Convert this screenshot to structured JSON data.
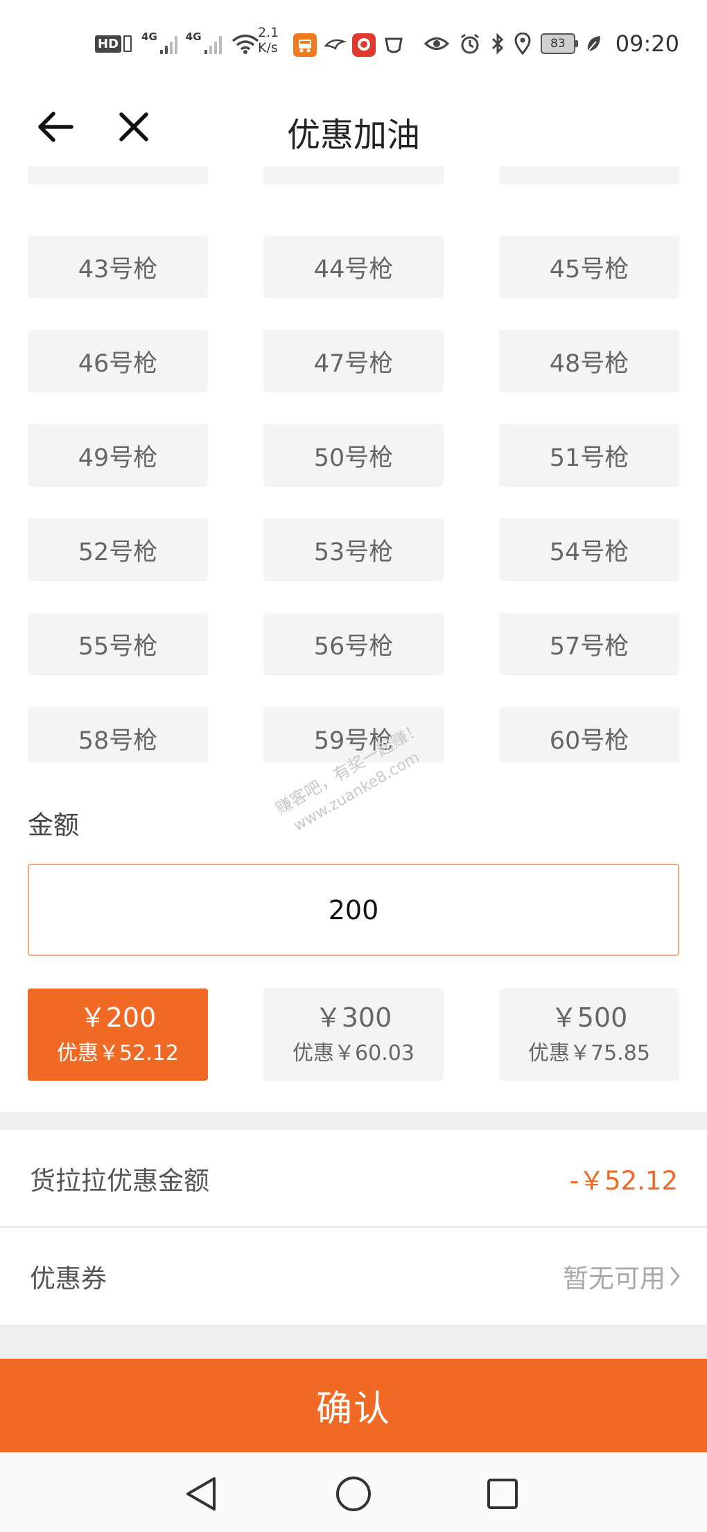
{
  "status_bar": {
    "hd": "HD",
    "net1": "4G",
    "net2": "4G",
    "speed_value": "2.1",
    "speed_unit": "K/s",
    "battery": "83",
    "time": "09:20"
  },
  "header": {
    "title": "优惠加油"
  },
  "nozzles": {
    "rows": [
      [
        "",
        "",
        ""
      ],
      [
        "43号枪",
        "44号枪",
        "45号枪"
      ],
      [
        "46号枪",
        "47号枪",
        "48号枪"
      ],
      [
        "49号枪",
        "50号枪",
        "51号枪"
      ],
      [
        "52号枪",
        "53号枪",
        "54号枪"
      ],
      [
        "55号枪",
        "56号枪",
        "57号枪"
      ],
      [
        "58号枪",
        "59号枪",
        "60号枪"
      ]
    ]
  },
  "amount": {
    "label": "金额",
    "value": "200"
  },
  "presets": [
    {
      "amount": "￥200",
      "discount": "优惠￥52.12",
      "selected": true
    },
    {
      "amount": "￥300",
      "discount": "优惠￥60.03",
      "selected": false
    },
    {
      "amount": "￥500",
      "discount": "优惠￥75.85",
      "selected": false
    }
  ],
  "summary": {
    "discount_label": "货拉拉优惠金额",
    "discount_value": "-￥52.12",
    "coupon_label": "优惠券",
    "coupon_value": "暂无可用"
  },
  "confirm_label": "确认",
  "colors": {
    "accent": "#f06a26",
    "tile_bg": "#f4f4f4",
    "input_border": "#f0a985"
  }
}
